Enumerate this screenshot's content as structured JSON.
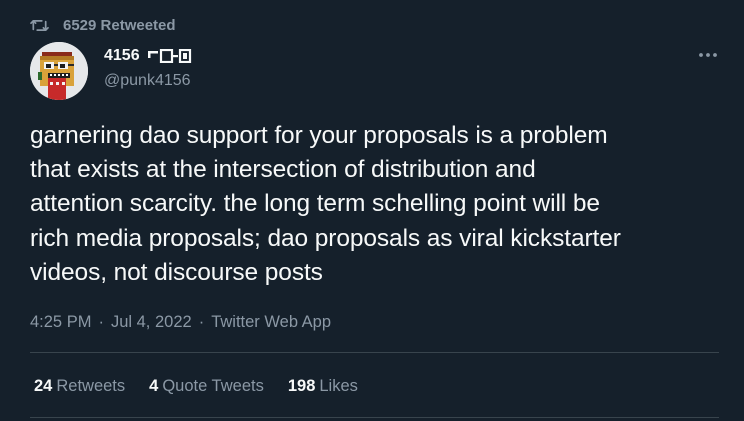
{
  "retweet": {
    "icon": "retweet-icon",
    "label": "6529 Retweeted"
  },
  "author": {
    "avatar_icon": "punk-avatar-icon",
    "display_name": "4156",
    "name_glyph_icon": "name-badge-icon",
    "handle": "@punk4156"
  },
  "more_icon": "more-icon",
  "tweet": {
    "text": "garnering dao support for your proposals is a problem\nthat exists at the intersection of distribution and\nattention scarcity. the long term schelling point will be\nrich media proposals; dao proposals as viral kickstarter\nvideos, not discourse posts",
    "time": "4:25 PM",
    "date": "Jul 4, 2022",
    "source": "Twitter Web App"
  },
  "stats": {
    "retweets_count": "24",
    "retweets_label": "Retweets",
    "quotes_count": "4",
    "quotes_label": "Quote Tweets",
    "likes_count": "198",
    "likes_label": "Likes"
  },
  "colors": {
    "background": "#15202b",
    "text_primary": "#f7f9f9",
    "text_secondary": "#8b98a5",
    "divider": "#38444d"
  }
}
